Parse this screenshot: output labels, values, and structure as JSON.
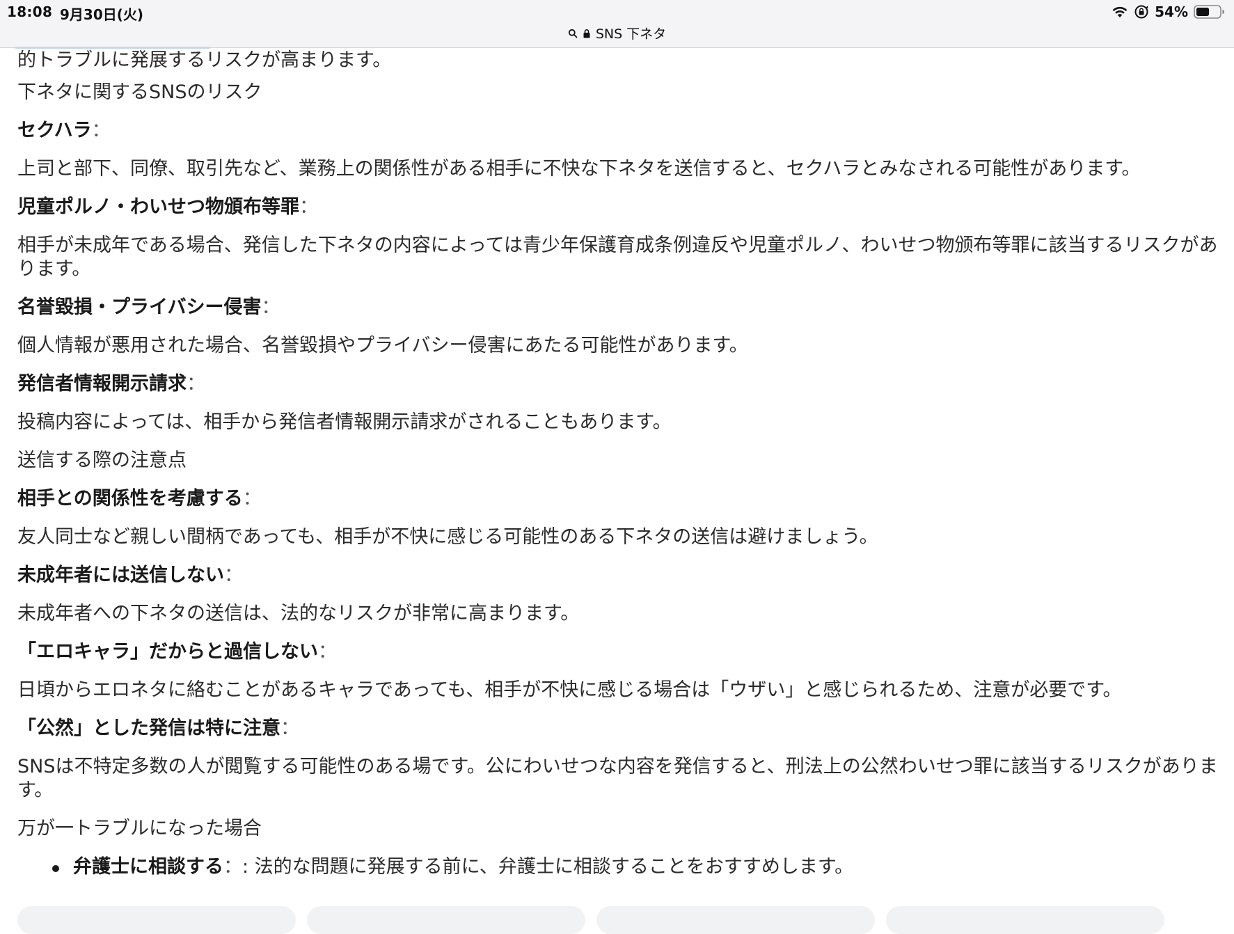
{
  "status_bar": {
    "time": "18:08",
    "date": "9月30日(火)",
    "battery": "54%"
  },
  "address_bar": {
    "query": "SNS 下ネタ"
  },
  "article": {
    "intro_tail": "的トラブルに発展するリスクが高まります。",
    "risk_heading": "下ネタに関するSNSのリスク",
    "risks": [
      {
        "term": "セクハラ",
        "sep": "：",
        "desc": "上司と部下、同僚、取引先など、業務上の関係性がある相手に不快な下ネタを送信すると、セクハラとみなされる可能性があります。"
      },
      {
        "term": "児童ポルノ・わいせつ物頒布等罪",
        "sep": "：",
        "desc": "相手が未成年である場合、発信した下ネタの内容によっては青少年保護育成条例違反や児童ポルノ、わいせつ物颁布等罪に該当するリスクがあります。"
      },
      {
        "term": "名誉毀損・プライバシー侵害",
        "sep": "：",
        "desc": "個人情報が悪用された場合、名誉毀損やプライバシー侵害にあたる可能性があります。"
      },
      {
        "term": "発信者情報開示請求",
        "sep": "：",
        "desc": "投稿内容によっては、相手から発信者情報開示請求がされることもあります。"
      }
    ],
    "caution_heading": "送信する際の注意点",
    "cautions": [
      {
        "term": "相手との関係性を考慮する",
        "sep": "：",
        "desc": "友人同士など親しい間柄であっても、相手が不快に感じる可能性のある下ネタの送信は避けましょう。"
      },
      {
        "term": "未成年者には送信しない",
        "sep": "：",
        "desc": "未成年者への下ネタの送信は、法的なリスクが非常に高まります。"
      },
      {
        "term": "「エロキャラ」だからと過信しない",
        "sep": "：",
        "desc": "日頃からエロネタに絡むことがあるキャラであっても、相手が不快に感じる場合は「ウザい」と感じられるため、注意が必要です。"
      },
      {
        "term": "「公然」とした発信は特に注意",
        "sep": "：",
        "desc": "SNSは不特定多数の人が閲覧する可能性のある場です。公にわいせつな内容を発信すると、刑法上の公然わいせつ罪に該当するリスクがあります。"
      }
    ],
    "trouble_heading": "万が一トラブルになった場合",
    "trouble_items": [
      {
        "term": "弁護士に相談する",
        "sep": "：",
        "desc": ": 法的な問題に発展する前に、弁護士に相談することをおすすめします。"
      }
    ]
  },
  "icons": {
    "wifi": "wifi-icon",
    "rotation_lock": "rotation-lock-icon",
    "battery": "battery-icon",
    "search": "search-icon",
    "lock": "lock-icon"
  }
}
